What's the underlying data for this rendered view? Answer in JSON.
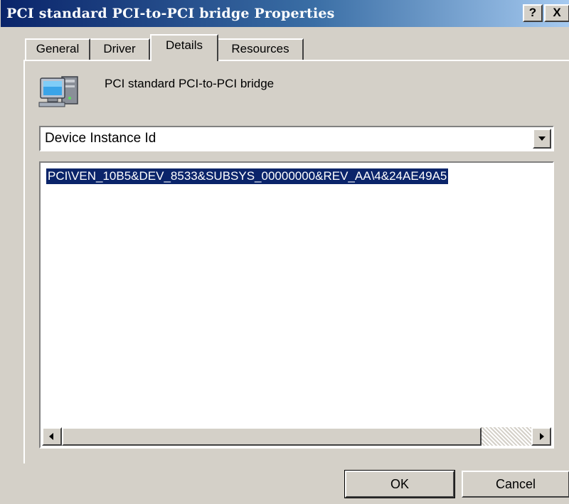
{
  "window": {
    "title": "PCI standard PCI-to-PCI bridge Properties",
    "help_label": "?",
    "close_label": "X"
  },
  "tabs": [
    {
      "label": "General",
      "active": false
    },
    {
      "label": "Driver",
      "active": false
    },
    {
      "label": "Details",
      "active": true
    },
    {
      "label": "Resources",
      "active": false
    }
  ],
  "device": {
    "icon": "computer-device-icon",
    "name": "PCI standard PCI-to-PCI bridge"
  },
  "property_select": {
    "selected": "Device Instance Id"
  },
  "values_list": {
    "items": [
      "PCI\\VEN_10B5&DEV_8533&SUBSYS_00000000&REV_AA\\4&24AE49A5"
    ]
  },
  "buttons": {
    "ok": "OK",
    "cancel": "Cancel"
  },
  "colors": {
    "titlebar_start": "#0a246a",
    "titlebar_end": "#a6caf0",
    "face": "#d4d0c8",
    "selection": "#0a246a"
  }
}
